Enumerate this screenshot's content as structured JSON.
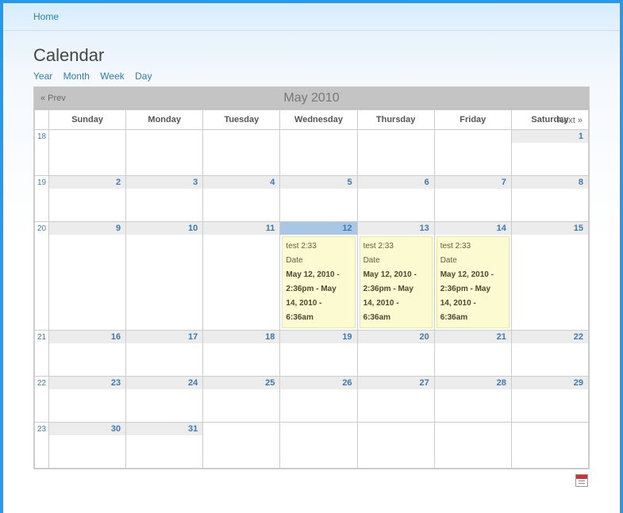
{
  "nav": {
    "home": "Home"
  },
  "page_title": "Calendar",
  "views": {
    "year": "Year",
    "month": "Month",
    "week": "Week",
    "day": "Day"
  },
  "calendar": {
    "prev": "« Prev",
    "next": "Next »",
    "month_label": "May 2010",
    "day_headers": [
      "Sunday",
      "Monday",
      "Tuesday",
      "Wednesday",
      "Thursday",
      "Friday",
      "Saturday"
    ],
    "weeks": [
      {
        "weeknum": "18",
        "days": [
          {
            "n": "",
            "other": true
          },
          {
            "n": "",
            "other": true
          },
          {
            "n": "",
            "other": true
          },
          {
            "n": "",
            "other": true
          },
          {
            "n": "",
            "other": true
          },
          {
            "n": "",
            "other": true
          },
          {
            "n": "1"
          }
        ]
      },
      {
        "weeknum": "19",
        "days": [
          {
            "n": "2"
          },
          {
            "n": "3"
          },
          {
            "n": "4"
          },
          {
            "n": "5"
          },
          {
            "n": "6"
          },
          {
            "n": "7"
          },
          {
            "n": "8"
          }
        ]
      },
      {
        "weeknum": "20",
        "days": [
          {
            "n": "9"
          },
          {
            "n": "10"
          },
          {
            "n": "11"
          },
          {
            "n": "12",
            "today": true,
            "event": true
          },
          {
            "n": "13",
            "event": true
          },
          {
            "n": "14",
            "event": true
          },
          {
            "n": "15"
          }
        ]
      },
      {
        "weeknum": "21",
        "days": [
          {
            "n": "16"
          },
          {
            "n": "17"
          },
          {
            "n": "18"
          },
          {
            "n": "19"
          },
          {
            "n": "20"
          },
          {
            "n": "21"
          },
          {
            "n": "22"
          }
        ]
      },
      {
        "weeknum": "22",
        "days": [
          {
            "n": "23"
          },
          {
            "n": "24"
          },
          {
            "n": "25"
          },
          {
            "n": "26"
          },
          {
            "n": "27"
          },
          {
            "n": "28"
          },
          {
            "n": "29"
          }
        ]
      },
      {
        "weeknum": "23",
        "days": [
          {
            "n": "30"
          },
          {
            "n": "31"
          },
          {
            "n": "",
            "other": true
          },
          {
            "n": "",
            "other": true
          },
          {
            "n": "",
            "other": true
          },
          {
            "n": "",
            "other": true
          },
          {
            "n": "",
            "other": true
          }
        ]
      }
    ],
    "event": {
      "title": "test 2:33",
      "label": "Date",
      "date_line1": "May 12, 2010 -",
      "date_line2": "2:36pm - May",
      "date_line3": "14, 2010 -",
      "date_line4": "6:36am"
    }
  }
}
